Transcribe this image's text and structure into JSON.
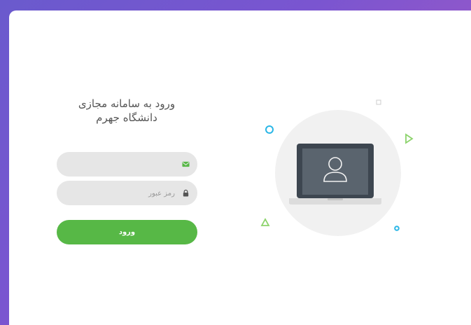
{
  "login": {
    "title_line1": "ورود به سامانه مجازی",
    "title_line2": "دانشگاه جهرم",
    "email_value": "",
    "email_placeholder": "",
    "password_value": "",
    "password_placeholder": "رمز عبور",
    "submit_label": "ورود"
  },
  "icons": {
    "email": "envelope-icon",
    "password": "lock-icon",
    "illustration": "laptop-user-icon"
  },
  "colors": {
    "accent_green": "#57b846",
    "background_gradient_start": "#6a5acd",
    "background_gradient_end": "#b15ac0",
    "field_bg": "#e6e6e6",
    "shape_blue": "#29b6e6",
    "shape_green": "#8cd36b"
  }
}
